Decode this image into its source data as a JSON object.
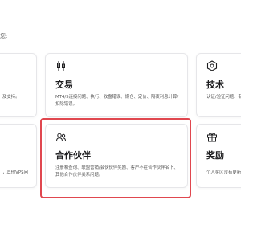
{
  "intro_text": "您:",
  "cards": [
    {
      "key": "top-left",
      "title": "",
      "desc": "及支持。",
      "icon": "none"
    },
    {
      "key": "trading",
      "title": "交易",
      "desc": "MT4/5连接问题、执行、收盘错误、爆仓、定价、隔夜利息计算/扣除错误。",
      "icon": "candlestick-chart-icon"
    },
    {
      "key": "technical",
      "title": "技术",
      "desc": "认证/验证问题、有",
      "icon": "hexagon-settings-icon"
    },
    {
      "key": "bottom-left",
      "title": "",
      "desc": "，其他VPS问",
      "icon": "none"
    },
    {
      "key": "partner",
      "title": "合作伙伴",
      "desc": "注册和查询、联盟营销/会伙伙伴奖励、客户不在合作伙伴名下、其他合作伙伴关系问题。",
      "icon": "users-icon"
    },
    {
      "key": "rewards",
      "title": "奖励",
      "desc": "个人奖区没有更新",
      "icon": "gift-icon"
    }
  ],
  "colors": {
    "highlight_border": "#e0474f",
    "card_border": "#e6e6e9",
    "text_primary": "#1d1d1f",
    "text_secondary": "#555555"
  }
}
